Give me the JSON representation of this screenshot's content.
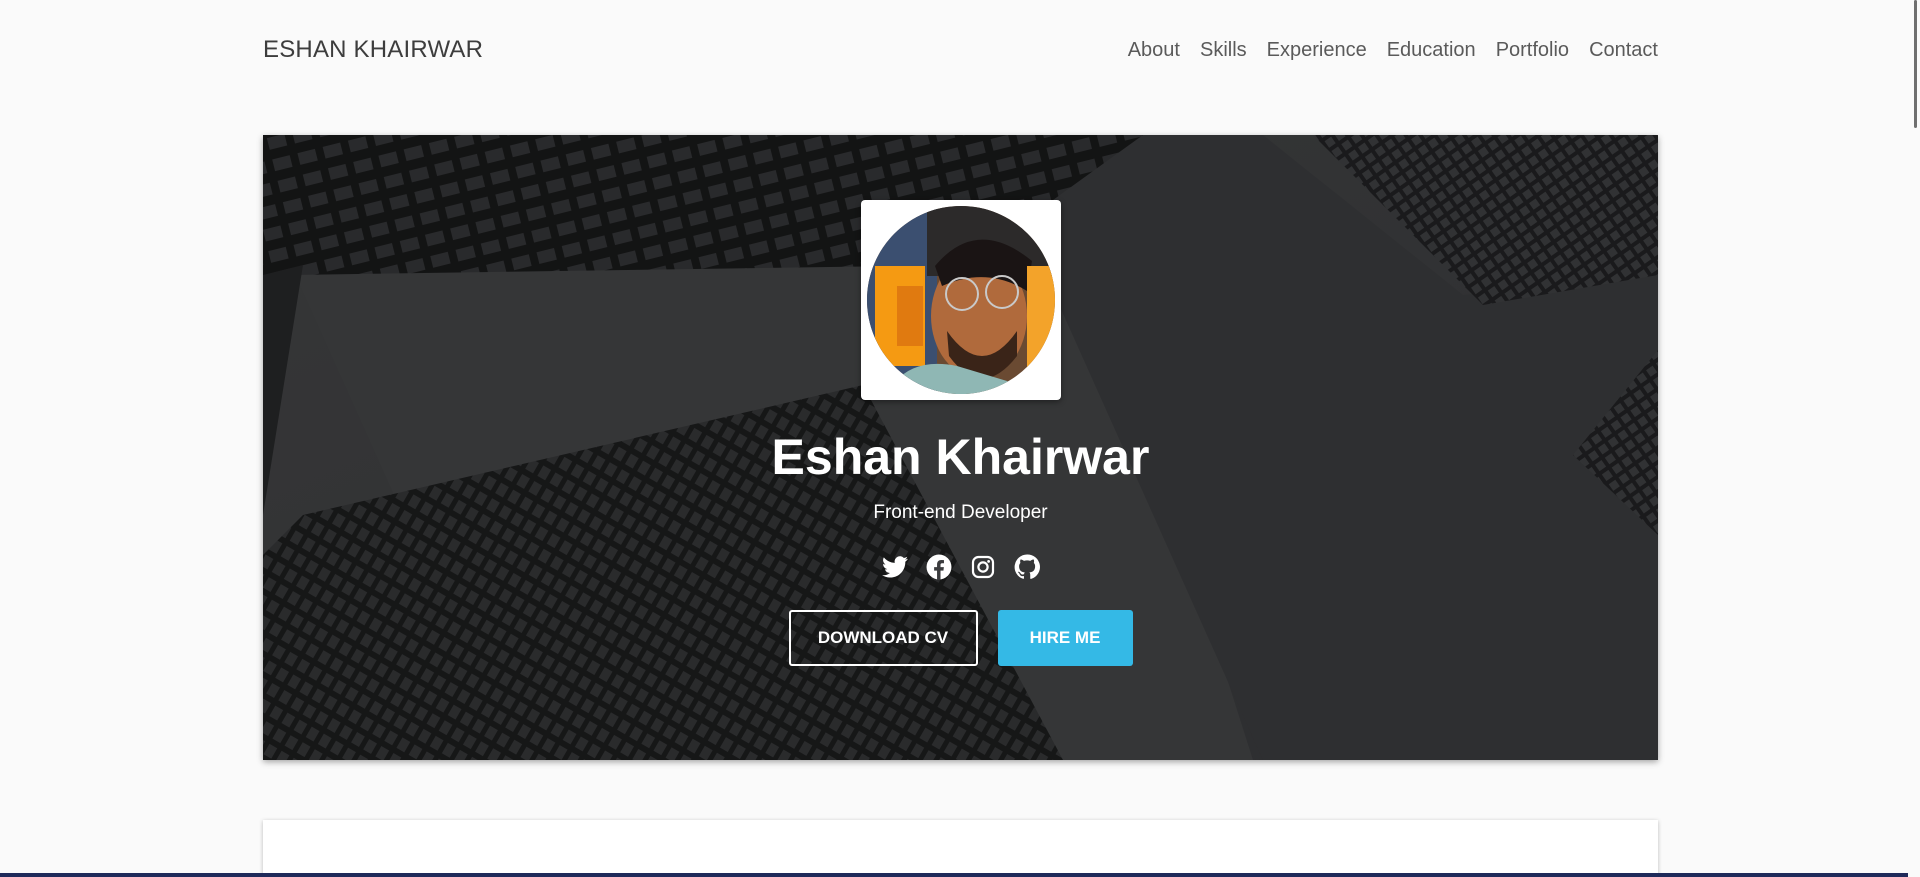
{
  "navbar": {
    "brand": "ESHAN KHAIRWAR",
    "links": [
      "About",
      "Skills",
      "Experience",
      "Education",
      "Portfolio",
      "Contact"
    ]
  },
  "hero": {
    "name": "Eshan Khairwar",
    "title": "Front-end Developer",
    "socials": [
      "twitter-icon",
      "facebook-icon",
      "instagram-icon",
      "github-icon"
    ],
    "buttons": {
      "download_cv": "DOWNLOAD CV",
      "hire_me": "HIRE ME"
    }
  },
  "colors": {
    "accent": "#34b9e6",
    "page_bg": "#fafafa",
    "hero_bg": "#2d2e30"
  }
}
